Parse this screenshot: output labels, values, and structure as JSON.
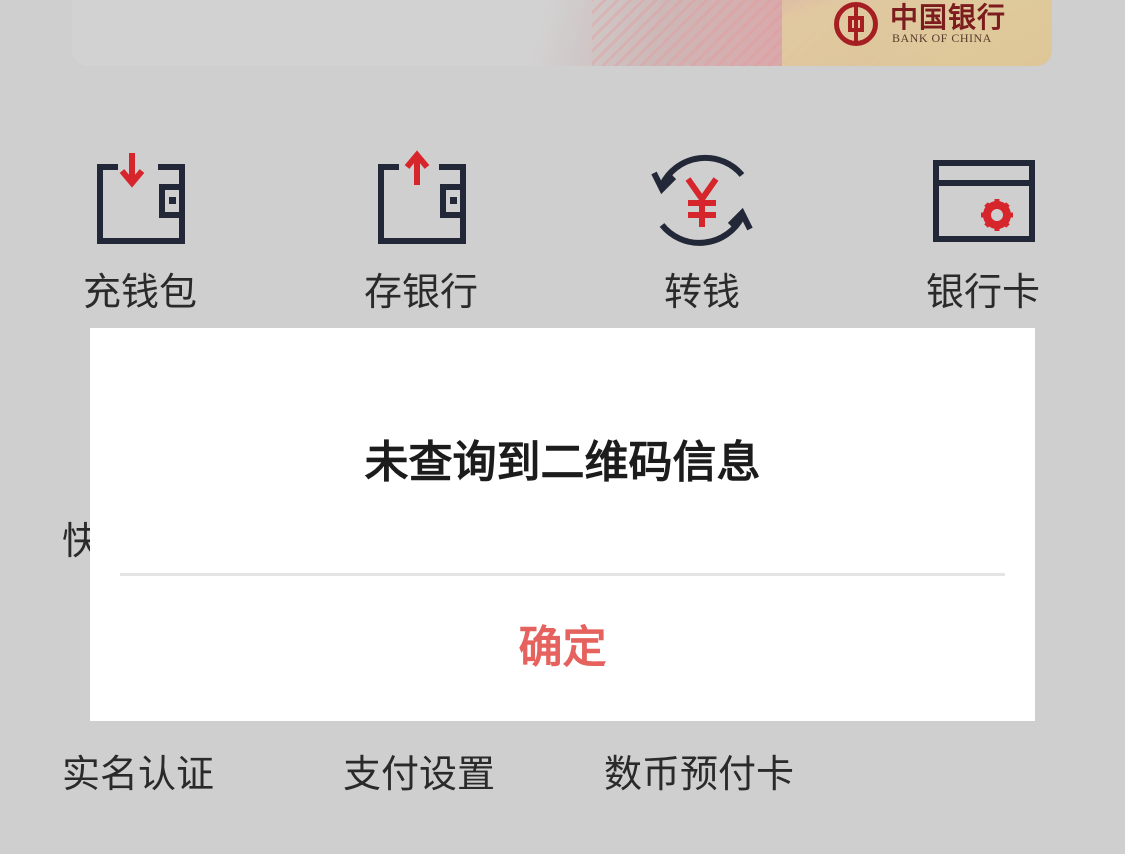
{
  "bank_card": {
    "logo_cn": "中国银行",
    "logo_en": "BANK OF CHINA",
    "icon": "bank-of-china-logo-icon"
  },
  "functions": [
    {
      "label": "充钱包",
      "icon": "wallet-recharge-icon"
    },
    {
      "label": "存银行",
      "icon": "wallet-deposit-icon"
    },
    {
      "label": "转钱",
      "icon": "yuan-transfer-icon"
    },
    {
      "label": "银行卡",
      "icon": "bank-card-icon"
    }
  ],
  "partial_label": "快",
  "bottom_items": [
    {
      "label": "实名认证"
    },
    {
      "label": "支付设置"
    },
    {
      "label": "数币预付卡"
    }
  ],
  "dialog": {
    "title": "未查询到二维码信息",
    "confirm_label": "确定"
  },
  "colors": {
    "accent_red": "#e5625e",
    "icon_dark": "#232838",
    "icon_red": "#d6262c",
    "overlay_bg": "#cfcfcf"
  }
}
